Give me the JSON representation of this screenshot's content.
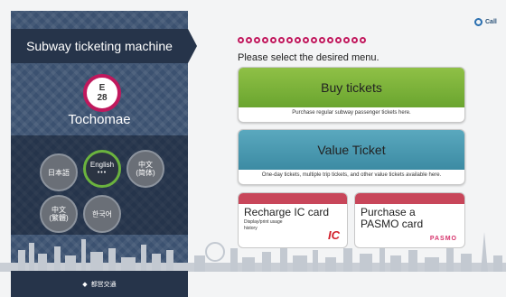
{
  "header": {
    "call_label": "Call"
  },
  "sidebar": {
    "title": "Subway ticketing machine",
    "line_letter": "E",
    "line_number": "28",
    "station": "Tochomae",
    "languages": [
      {
        "label": "日本語",
        "extra": ""
      },
      {
        "label": "English",
        "extra": "•••"
      },
      {
        "label": "中文",
        "extra": "(简体)"
      },
      {
        "label": "中文",
        "extra": "(繁體)"
      },
      {
        "label": "한국어",
        "extra": ""
      }
    ],
    "footer": "都営交通"
  },
  "main": {
    "prompt": "Please select the desired menu.",
    "buy": {
      "label": "Buy tickets",
      "desc": "Purchase regular subway passenger tickets here."
    },
    "value": {
      "label": "Value Ticket",
      "desc": "One-day tickets, multiple trip tickets, and other value tickets available here."
    },
    "recharge": {
      "line1": "Recharge IC card",
      "sub1": "Display/print usage",
      "sub2": "history",
      "logo": "IC"
    },
    "pasmo": {
      "line1": "Purchase a",
      "line2": "PASMO card",
      "logo": "PASMO"
    }
  },
  "colors": {
    "accent": "#c0185d",
    "buy": "#7ab23a",
    "value": "#4a98b0",
    "card_strip": "#c8465a",
    "panel": "#3b5170"
  }
}
